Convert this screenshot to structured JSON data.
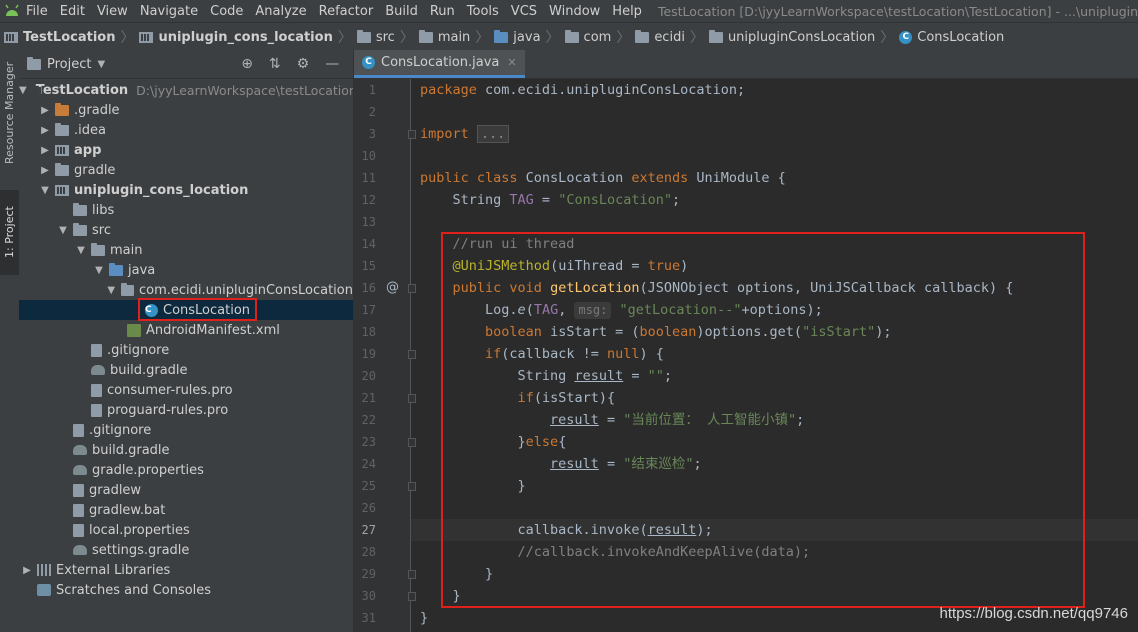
{
  "menubar": {
    "items": [
      "File",
      "Edit",
      "View",
      "Navigate",
      "Code",
      "Analyze",
      "Refactor",
      "Build",
      "Run",
      "Tools",
      "VCS",
      "Window",
      "Help"
    ],
    "title": "TestLocation [D:\\jyyLearnWorkspace\\testLocation\\TestLocation] - ...\\uniplugin_cons_location"
  },
  "breadcrumb": [
    "TestLocation",
    "uniplugin_cons_location",
    "src",
    "main",
    "java",
    "com",
    "ecidi",
    "unipluginConsLocation",
    "ConsLocation"
  ],
  "left_strip": {
    "resource_manager": "Resource Manager",
    "project_tab": "1: Project"
  },
  "project_panel": {
    "title": "Project",
    "tree": [
      {
        "label": "TestLocation",
        "hint": "D:\\jyyLearnWorkspace\\testLocation\\",
        "depth": 0,
        "arrow": "down",
        "icon": "module-icon",
        "bold": true
      },
      {
        "label": ".gradle",
        "depth": 1,
        "arrow": "right",
        "icon": "folder-orange-icon"
      },
      {
        "label": ".idea",
        "depth": 1,
        "arrow": "right",
        "icon": "folder-icon"
      },
      {
        "label": "app",
        "depth": 1,
        "arrow": "right",
        "icon": "module-icon",
        "bold": true
      },
      {
        "label": "gradle",
        "depth": 1,
        "arrow": "right",
        "icon": "folder-icon"
      },
      {
        "label": "uniplugin_cons_location",
        "depth": 1,
        "arrow": "down",
        "icon": "module-icon",
        "bold": true
      },
      {
        "label": "libs",
        "depth": 2,
        "arrow": "",
        "icon": "folder-icon"
      },
      {
        "label": "src",
        "depth": 2,
        "arrow": "down",
        "icon": "folder-icon"
      },
      {
        "label": "main",
        "depth": 3,
        "arrow": "down",
        "icon": "folder-icon"
      },
      {
        "label": "java",
        "depth": 4,
        "arrow": "down",
        "icon": "folder-blue-icon"
      },
      {
        "label": "com.ecidi.unipluginConsLocation",
        "depth": 5,
        "arrow": "down",
        "icon": "package-icon"
      },
      {
        "label": "ConsLocation",
        "depth": 6,
        "arrow": "",
        "icon": "class-icon",
        "selected": true
      },
      {
        "label": "AndroidManifest.xml",
        "depth": 5,
        "arrow": "",
        "icon": "xml-icon"
      },
      {
        "label": ".gitignore",
        "depth": 3,
        "arrow": "",
        "icon": "file-icon"
      },
      {
        "label": "build.gradle",
        "depth": 3,
        "arrow": "",
        "icon": "gradle-icon"
      },
      {
        "label": "consumer-rules.pro",
        "depth": 3,
        "arrow": "",
        "icon": "file-icon"
      },
      {
        "label": "proguard-rules.pro",
        "depth": 3,
        "arrow": "",
        "icon": "file-icon"
      },
      {
        "label": ".gitignore",
        "depth": 2,
        "arrow": "",
        "icon": "file-icon"
      },
      {
        "label": "build.gradle",
        "depth": 2,
        "arrow": "",
        "icon": "gradle-icon"
      },
      {
        "label": "gradle.properties",
        "depth": 2,
        "arrow": "",
        "icon": "gradle-icon"
      },
      {
        "label": "gradlew",
        "depth": 2,
        "arrow": "",
        "icon": "file-icon"
      },
      {
        "label": "gradlew.bat",
        "depth": 2,
        "arrow": "",
        "icon": "file-icon"
      },
      {
        "label": "local.properties",
        "depth": 2,
        "arrow": "",
        "icon": "file-icon"
      },
      {
        "label": "settings.gradle",
        "depth": 2,
        "arrow": "",
        "icon": "gradle-icon"
      },
      {
        "label": "External Libraries",
        "depth": 0,
        "arrow": "right",
        "icon": "library-icon"
      },
      {
        "label": "Scratches and Consoles",
        "depth": 0,
        "arrow": "",
        "icon": "scratch-icon"
      }
    ]
  },
  "editor": {
    "tab": "ConsLocation.java",
    "current_line": 27,
    "lines": [
      {
        "n": 1,
        "html": "<span class='kw'>package</span> com.ecidi.unipluginConsLocation;"
      },
      {
        "n": 2,
        "html": ""
      },
      {
        "n": 3,
        "html": "<span class='kw'>import</span> <span class='fold-box'>...</span>"
      },
      {
        "n": 10,
        "html": ""
      },
      {
        "n": 11,
        "html": "<span class='kw'>public class</span> ConsLocation <span class='kw'>extends</span> UniModule {"
      },
      {
        "n": 12,
        "html": "    String <span class='fld'>TAG</span> = <span class='str'>\"ConsLocation\"</span>;"
      },
      {
        "n": 13,
        "html": ""
      },
      {
        "n": 14,
        "html": "    <span class='cmt'>//run ui thread</span>"
      },
      {
        "n": 15,
        "html": "    <span class='ann'>@UniJSMethod</span>(uiThread = <span class='kw'>true</span>)"
      },
      {
        "n": 16,
        "html": "    <span class='kw'>public void</span> <span class='fn'>getLocation</span>(JSONObject options, UniJSCallback callback) {"
      },
      {
        "n": 17,
        "html": "        Log.<i>e</i>(<span class='fld'>TAG</span>, <span class='hintlabel'>msg:</span> <span class='str'>\"getLocation--\"</span>+options);"
      },
      {
        "n": 18,
        "html": "        <span class='kw'>boolean</span> isStart = (<span class='kw'>boolean</span>)options.get(<span class='str'>\"isStart\"</span>);"
      },
      {
        "n": 19,
        "html": "        <span class='kw'>if</span>(callback != <span class='kw'>null</span>) {"
      },
      {
        "n": 20,
        "html": "            String <span class='ul'>result</span> = <span class='str'>\"\"</span>;"
      },
      {
        "n": 21,
        "html": "            <span class='kw'>if</span>(isStart){"
      },
      {
        "n": 22,
        "html": "                <span class='ul'>result</span> = <span class='str'>\"当前位置： 人工智能小镇\"</span>;"
      },
      {
        "n": 23,
        "html": "            }<span class='kw'>else</span>{"
      },
      {
        "n": 24,
        "html": "                <span class='ul'>result</span> = <span class='str'>\"结束巡检\"</span>;"
      },
      {
        "n": 25,
        "html": "            }"
      },
      {
        "n": 26,
        "html": ""
      },
      {
        "n": 27,
        "html": "            callback.invoke(<span class='ul'>result</span>);"
      },
      {
        "n": 28,
        "html": "            <span class='cmt'>//callback.invokeAndKeepAlive(data);</span>"
      },
      {
        "n": 29,
        "html": "        }"
      },
      {
        "n": 30,
        "html": "    }"
      },
      {
        "n": 31,
        "html": "}"
      }
    ],
    "gutter_marks": [
      {
        "line": 16,
        "mark": "@"
      }
    ]
  },
  "watermark": "https://blog.csdn.net/qq9746",
  "colors": {
    "highlight_box": "#e0201b",
    "selection": "#0d293e",
    "accent_tab": "#4a88c7"
  }
}
